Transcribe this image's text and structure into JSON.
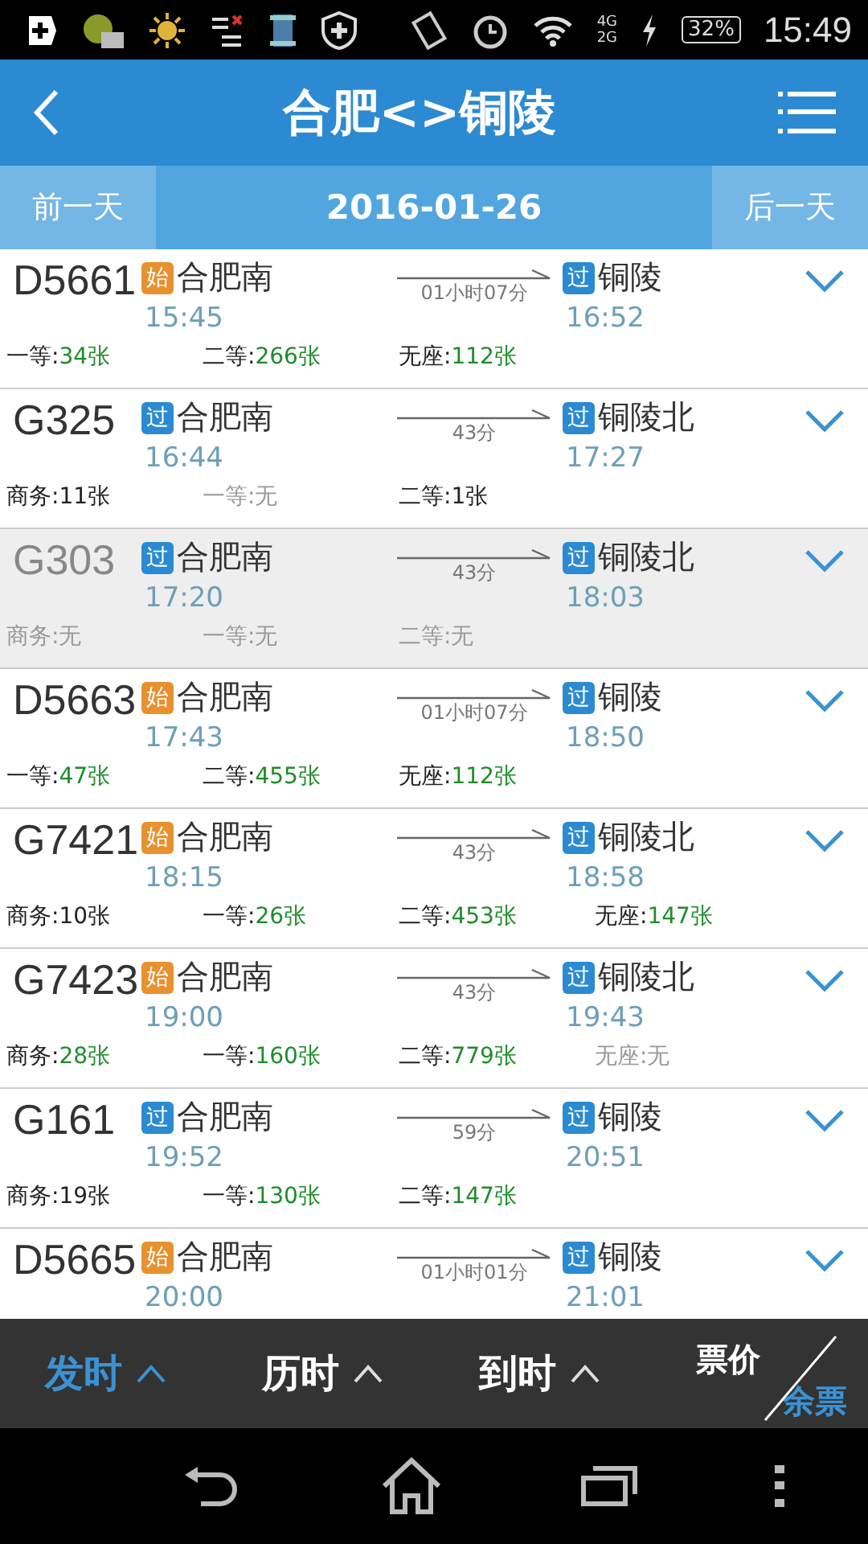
{
  "status_bar": {
    "network": [
      "4G",
      "2G"
    ],
    "battery": "32%",
    "time": "15:49"
  },
  "header": {
    "title": "合肥<>铜陵"
  },
  "date_bar": {
    "prev": "前一天",
    "date": "2016-01-26",
    "next": "后一天"
  },
  "trains": [
    {
      "number": "D5661",
      "disabled": false,
      "from_tag": {
        "kind": "start",
        "label": "始"
      },
      "from": "合肥南",
      "depart": "15:45",
      "duration": "01小时07分",
      "to_tag": {
        "kind": "pass",
        "label": "过"
      },
      "to": "铜陵",
      "arrive": "16:52",
      "seats": [
        {
          "label": "一等:",
          "count": "34张",
          "kind": "plenty"
        },
        {
          "label": "二等:",
          "count": "266张",
          "kind": "plenty"
        },
        {
          "label": "无座:",
          "count": "112张",
          "kind": "plenty"
        }
      ]
    },
    {
      "number": "G325",
      "disabled": false,
      "from_tag": {
        "kind": "pass",
        "label": "过"
      },
      "from": "合肥南",
      "depart": "16:44",
      "duration": "43分",
      "to_tag": {
        "kind": "pass",
        "label": "过"
      },
      "to": "铜陵北",
      "arrive": "17:27",
      "seats": [
        {
          "label": "商务:",
          "count": "11张",
          "kind": "few"
        },
        {
          "label": "一等:",
          "count": "无",
          "kind": "none"
        },
        {
          "label": "二等:",
          "count": "1张",
          "kind": "few"
        }
      ]
    },
    {
      "number": "G303",
      "disabled": true,
      "from_tag": {
        "kind": "pass",
        "label": "过"
      },
      "from": "合肥南",
      "depart": "17:20",
      "duration": "43分",
      "to_tag": {
        "kind": "pass",
        "label": "过"
      },
      "to": "铜陵北",
      "arrive": "18:03",
      "seats": [
        {
          "label": "商务:",
          "count": "无",
          "kind": "none"
        },
        {
          "label": "一等:",
          "count": "无",
          "kind": "none"
        },
        {
          "label": "二等:",
          "count": "无",
          "kind": "none"
        }
      ]
    },
    {
      "number": "D5663",
      "disabled": false,
      "from_tag": {
        "kind": "start",
        "label": "始"
      },
      "from": "合肥南",
      "depart": "17:43",
      "duration": "01小时07分",
      "to_tag": {
        "kind": "pass",
        "label": "过"
      },
      "to": "铜陵",
      "arrive": "18:50",
      "seats": [
        {
          "label": "一等:",
          "count": "47张",
          "kind": "plenty"
        },
        {
          "label": "二等:",
          "count": "455张",
          "kind": "plenty"
        },
        {
          "label": "无座:",
          "count": "112张",
          "kind": "plenty"
        }
      ]
    },
    {
      "number": "G7421",
      "disabled": false,
      "from_tag": {
        "kind": "start",
        "label": "始"
      },
      "from": "合肥南",
      "depart": "18:15",
      "duration": "43分",
      "to_tag": {
        "kind": "pass",
        "label": "过"
      },
      "to": "铜陵北",
      "arrive": "18:58",
      "seats": [
        {
          "label": "商务:",
          "count": "10张",
          "kind": "few"
        },
        {
          "label": "一等:",
          "count": "26张",
          "kind": "plenty"
        },
        {
          "label": "二等:",
          "count": "453张",
          "kind": "plenty"
        },
        {
          "label": "无座:",
          "count": "147张",
          "kind": "plenty"
        }
      ]
    },
    {
      "number": "G7423",
      "disabled": false,
      "from_tag": {
        "kind": "start",
        "label": "始"
      },
      "from": "合肥南",
      "depart": "19:00",
      "duration": "43分",
      "to_tag": {
        "kind": "pass",
        "label": "过"
      },
      "to": "铜陵北",
      "arrive": "19:43",
      "seats": [
        {
          "label": "商务:",
          "count": "28张",
          "kind": "plenty"
        },
        {
          "label": "一等:",
          "count": "160张",
          "kind": "plenty"
        },
        {
          "label": "二等:",
          "count": "779张",
          "kind": "plenty"
        },
        {
          "label": "无座:",
          "count": "无",
          "kind": "none"
        }
      ]
    },
    {
      "number": "G161",
      "disabled": false,
      "from_tag": {
        "kind": "pass",
        "label": "过"
      },
      "from": "合肥南",
      "depart": "19:52",
      "duration": "59分",
      "to_tag": {
        "kind": "pass",
        "label": "过"
      },
      "to": "铜陵",
      "arrive": "20:51",
      "seats": [
        {
          "label": "商务:",
          "count": "19张",
          "kind": "few"
        },
        {
          "label": "一等:",
          "count": "130张",
          "kind": "plenty"
        },
        {
          "label": "二等:",
          "count": "147张",
          "kind": "plenty"
        }
      ]
    },
    {
      "number": "D5665",
      "disabled": false,
      "from_tag": {
        "kind": "start",
        "label": "始"
      },
      "from": "合肥南",
      "depart": "20:00",
      "duration": "01小时01分",
      "to_tag": {
        "kind": "pass",
        "label": "过"
      },
      "to": "铜陵",
      "arrive": "21:01"
    }
  ],
  "sort_bar": {
    "items": [
      {
        "label": "发时",
        "selected": true
      },
      {
        "label": "历时",
        "selected": false
      },
      {
        "label": "到时",
        "selected": false
      }
    ],
    "toggle": [
      {
        "label": "票价",
        "selected": false
      },
      {
        "label": "余票",
        "selected": true
      }
    ]
  }
}
